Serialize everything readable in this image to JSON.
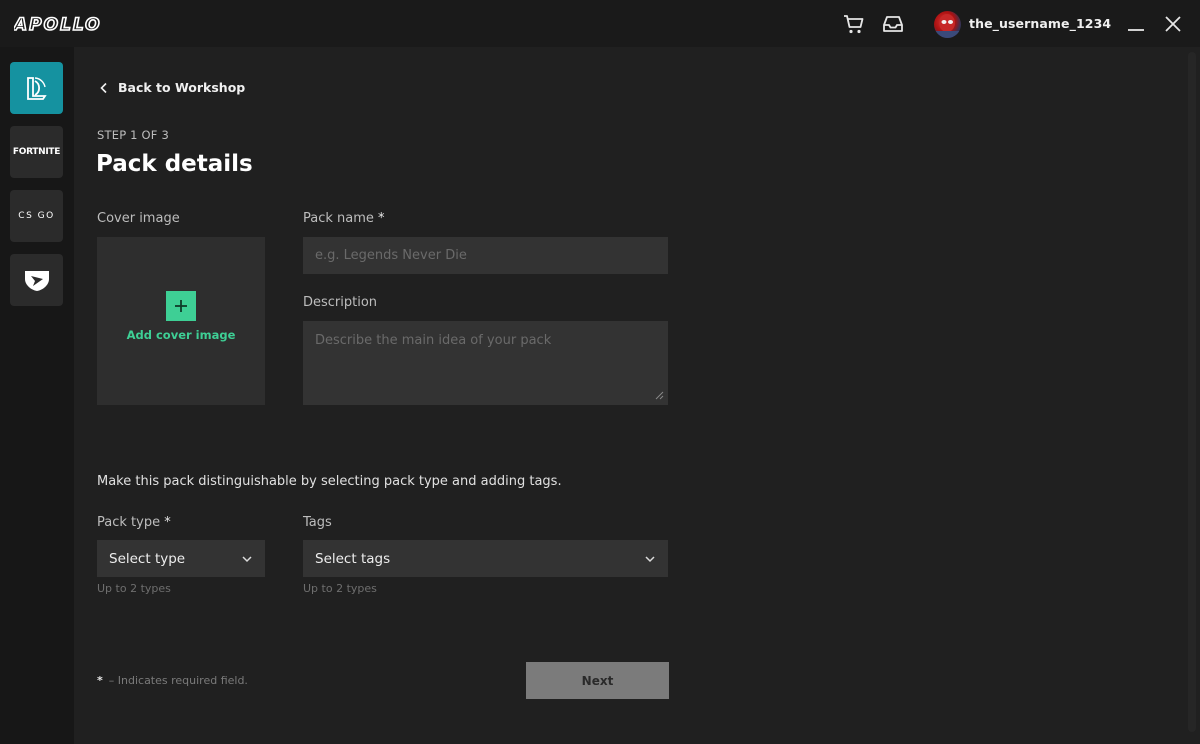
{
  "app": {
    "brand": "APOLLO"
  },
  "header": {
    "username": "the_username_1234",
    "icons": {
      "cart": "cart-icon",
      "inbox": "inbox-icon",
      "minimize": "minimize-icon",
      "close": "close-icon"
    }
  },
  "sidebar": {
    "items": [
      {
        "name": "League of Legends",
        "icon": "league-logo-icon",
        "active": true
      },
      {
        "name": "Fortnite",
        "icon_text": "FORTNITE",
        "active": false
      },
      {
        "name": "CS:GO",
        "icon_text": "CS GO",
        "active": false
      },
      {
        "name": "Rocket League",
        "icon": "rocket-league-logo-icon",
        "active": false
      }
    ]
  },
  "main": {
    "back_label": "Back to Workshop",
    "step": "STEP 1 OF 3",
    "title": "Pack details",
    "cover": {
      "label": "Cover image",
      "add_label": "Add cover image"
    },
    "pack_name": {
      "label": "Pack name",
      "required": "*",
      "placeholder": "e.g. Legends Never Die",
      "value": ""
    },
    "description": {
      "label": "Description",
      "placeholder": "Describe the main idea of your pack",
      "value": ""
    },
    "hint": "Make this pack distinguishable by selecting pack type and adding tags.",
    "pack_type": {
      "label": "Pack type",
      "required": "*",
      "value": "Select type",
      "sublabel": "Up to 2 types"
    },
    "tags": {
      "label": "Tags",
      "value": "Select tags",
      "sublabel": "Up to 2 types"
    },
    "footnote": {
      "star": "*",
      "text": "–  Indicates required field."
    },
    "next_label": "Next"
  },
  "colors": {
    "accent_teal": "#1592a0",
    "accent_green": "#3ecf95",
    "background": "#202020",
    "input": "#333333"
  }
}
